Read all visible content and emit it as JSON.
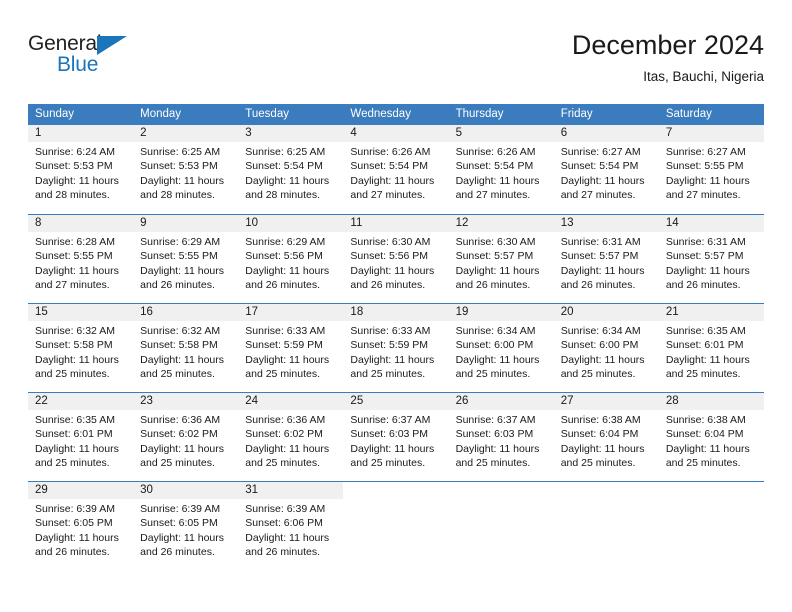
{
  "logo": {
    "word_top": "General",
    "word_bottom": "Blue",
    "triangle_color": "#1b75bb",
    "text_color": "#231f20"
  },
  "header": {
    "title": "December 2024",
    "location": "Itas, Bauchi, Nigeria"
  },
  "theme": {
    "header_blue": "#3a7cbe",
    "day_band_gray": "#f0f0f0",
    "text": "#1a1a1a"
  },
  "weekdays": [
    "Sunday",
    "Monday",
    "Tuesday",
    "Wednesday",
    "Thursday",
    "Friday",
    "Saturday"
  ],
  "weeks": [
    [
      {
        "day": "1",
        "sunrise": "Sunrise: 6:24 AM",
        "sunset": "Sunset: 5:53 PM",
        "daylight": "Daylight: 11 hours and 28 minutes."
      },
      {
        "day": "2",
        "sunrise": "Sunrise: 6:25 AM",
        "sunset": "Sunset: 5:53 PM",
        "daylight": "Daylight: 11 hours and 28 minutes."
      },
      {
        "day": "3",
        "sunrise": "Sunrise: 6:25 AM",
        "sunset": "Sunset: 5:54 PM",
        "daylight": "Daylight: 11 hours and 28 minutes."
      },
      {
        "day": "4",
        "sunrise": "Sunrise: 6:26 AM",
        "sunset": "Sunset: 5:54 PM",
        "daylight": "Daylight: 11 hours and 27 minutes."
      },
      {
        "day": "5",
        "sunrise": "Sunrise: 6:26 AM",
        "sunset": "Sunset: 5:54 PM",
        "daylight": "Daylight: 11 hours and 27 minutes."
      },
      {
        "day": "6",
        "sunrise": "Sunrise: 6:27 AM",
        "sunset": "Sunset: 5:54 PM",
        "daylight": "Daylight: 11 hours and 27 minutes."
      },
      {
        "day": "7",
        "sunrise": "Sunrise: 6:27 AM",
        "sunset": "Sunset: 5:55 PM",
        "daylight": "Daylight: 11 hours and 27 minutes."
      }
    ],
    [
      {
        "day": "8",
        "sunrise": "Sunrise: 6:28 AM",
        "sunset": "Sunset: 5:55 PM",
        "daylight": "Daylight: 11 hours and 27 minutes."
      },
      {
        "day": "9",
        "sunrise": "Sunrise: 6:29 AM",
        "sunset": "Sunset: 5:55 PM",
        "daylight": "Daylight: 11 hours and 26 minutes."
      },
      {
        "day": "10",
        "sunrise": "Sunrise: 6:29 AM",
        "sunset": "Sunset: 5:56 PM",
        "daylight": "Daylight: 11 hours and 26 minutes."
      },
      {
        "day": "11",
        "sunrise": "Sunrise: 6:30 AM",
        "sunset": "Sunset: 5:56 PM",
        "daylight": "Daylight: 11 hours and 26 minutes."
      },
      {
        "day": "12",
        "sunrise": "Sunrise: 6:30 AM",
        "sunset": "Sunset: 5:57 PM",
        "daylight": "Daylight: 11 hours and 26 minutes."
      },
      {
        "day": "13",
        "sunrise": "Sunrise: 6:31 AM",
        "sunset": "Sunset: 5:57 PM",
        "daylight": "Daylight: 11 hours and 26 minutes."
      },
      {
        "day": "14",
        "sunrise": "Sunrise: 6:31 AM",
        "sunset": "Sunset: 5:57 PM",
        "daylight": "Daylight: 11 hours and 26 minutes."
      }
    ],
    [
      {
        "day": "15",
        "sunrise": "Sunrise: 6:32 AM",
        "sunset": "Sunset: 5:58 PM",
        "daylight": "Daylight: 11 hours and 25 minutes."
      },
      {
        "day": "16",
        "sunrise": "Sunrise: 6:32 AM",
        "sunset": "Sunset: 5:58 PM",
        "daylight": "Daylight: 11 hours and 25 minutes."
      },
      {
        "day": "17",
        "sunrise": "Sunrise: 6:33 AM",
        "sunset": "Sunset: 5:59 PM",
        "daylight": "Daylight: 11 hours and 25 minutes."
      },
      {
        "day": "18",
        "sunrise": "Sunrise: 6:33 AM",
        "sunset": "Sunset: 5:59 PM",
        "daylight": "Daylight: 11 hours and 25 minutes."
      },
      {
        "day": "19",
        "sunrise": "Sunrise: 6:34 AM",
        "sunset": "Sunset: 6:00 PM",
        "daylight": "Daylight: 11 hours and 25 minutes."
      },
      {
        "day": "20",
        "sunrise": "Sunrise: 6:34 AM",
        "sunset": "Sunset: 6:00 PM",
        "daylight": "Daylight: 11 hours and 25 minutes."
      },
      {
        "day": "21",
        "sunrise": "Sunrise: 6:35 AM",
        "sunset": "Sunset: 6:01 PM",
        "daylight": "Daylight: 11 hours and 25 minutes."
      }
    ],
    [
      {
        "day": "22",
        "sunrise": "Sunrise: 6:35 AM",
        "sunset": "Sunset: 6:01 PM",
        "daylight": "Daylight: 11 hours and 25 minutes."
      },
      {
        "day": "23",
        "sunrise": "Sunrise: 6:36 AM",
        "sunset": "Sunset: 6:02 PM",
        "daylight": "Daylight: 11 hours and 25 minutes."
      },
      {
        "day": "24",
        "sunrise": "Sunrise: 6:36 AM",
        "sunset": "Sunset: 6:02 PM",
        "daylight": "Daylight: 11 hours and 25 minutes."
      },
      {
        "day": "25",
        "sunrise": "Sunrise: 6:37 AM",
        "sunset": "Sunset: 6:03 PM",
        "daylight": "Daylight: 11 hours and 25 minutes."
      },
      {
        "day": "26",
        "sunrise": "Sunrise: 6:37 AM",
        "sunset": "Sunset: 6:03 PM",
        "daylight": "Daylight: 11 hours and 25 minutes."
      },
      {
        "day": "27",
        "sunrise": "Sunrise: 6:38 AM",
        "sunset": "Sunset: 6:04 PM",
        "daylight": "Daylight: 11 hours and 25 minutes."
      },
      {
        "day": "28",
        "sunrise": "Sunrise: 6:38 AM",
        "sunset": "Sunset: 6:04 PM",
        "daylight": "Daylight: 11 hours and 25 minutes."
      }
    ],
    [
      {
        "day": "29",
        "sunrise": "Sunrise: 6:39 AM",
        "sunset": "Sunset: 6:05 PM",
        "daylight": "Daylight: 11 hours and 26 minutes."
      },
      {
        "day": "30",
        "sunrise": "Sunrise: 6:39 AM",
        "sunset": "Sunset: 6:05 PM",
        "daylight": "Daylight: 11 hours and 26 minutes."
      },
      {
        "day": "31",
        "sunrise": "Sunrise: 6:39 AM",
        "sunset": "Sunset: 6:06 PM",
        "daylight": "Daylight: 11 hours and 26 minutes."
      },
      {
        "day": "",
        "sunrise": "",
        "sunset": "",
        "daylight": ""
      },
      {
        "day": "",
        "sunrise": "",
        "sunset": "",
        "daylight": ""
      },
      {
        "day": "",
        "sunrise": "",
        "sunset": "",
        "daylight": ""
      },
      {
        "day": "",
        "sunrise": "",
        "sunset": "",
        "daylight": ""
      }
    ]
  ]
}
